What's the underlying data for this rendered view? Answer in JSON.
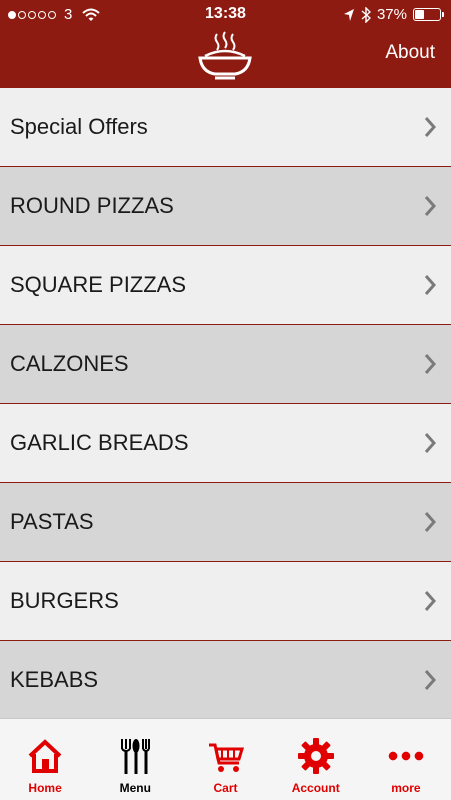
{
  "status_bar": {
    "carrier": "3",
    "time": "13:38",
    "battery": "37%",
    "battery_level": 0.37
  },
  "header": {
    "logo_icon": "noodle-bowl-icon",
    "about_label": "About"
  },
  "menu": {
    "items": [
      {
        "label": "Special Offers"
      },
      {
        "label": "ROUND PIZZAS"
      },
      {
        "label": "SQUARE PIZZAS"
      },
      {
        "label": "CALZONES"
      },
      {
        "label": "GARLIC BREADS"
      },
      {
        "label": "PASTAS"
      },
      {
        "label": "BURGERS"
      },
      {
        "label": "KEBABS"
      }
    ]
  },
  "tabbar": {
    "tabs": [
      {
        "label": "Home",
        "icon": "home-icon"
      },
      {
        "label": "Menu",
        "icon": "cutlery-icon"
      },
      {
        "label": "Cart",
        "icon": "cart-icon"
      },
      {
        "label": "Account",
        "icon": "gear-icon"
      },
      {
        "label": "more",
        "icon": "more-dots-icon"
      }
    ]
  },
  "colors": {
    "brand": "#8e1b11",
    "tab_accent": "#e10000"
  }
}
